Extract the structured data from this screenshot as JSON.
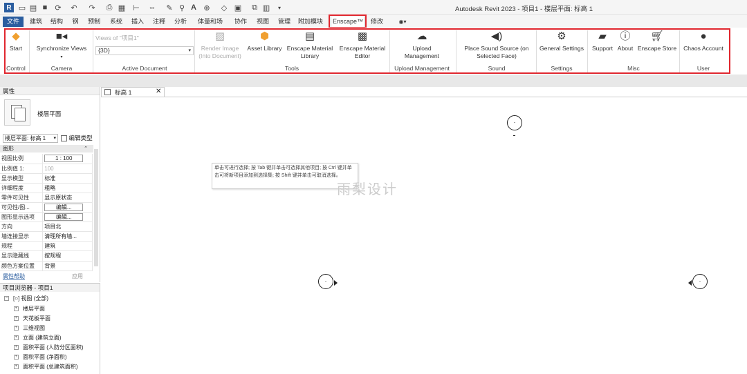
{
  "app": {
    "title": "Autodesk Revit 2023 - 项目1 - 楼层平面: 标高 1"
  },
  "tabs": [
    "文件",
    "建筑",
    "结构",
    "钢",
    "预制",
    "系统",
    "插入",
    "注释",
    "分析",
    "体量和场地",
    "协作",
    "视图",
    "管理",
    "附加模块",
    "Enscape™",
    "修改"
  ],
  "ribbon": {
    "start": "Start",
    "sync_views": "Synchronize Views",
    "views_placeholder": "Views of \"项目1\"",
    "active_view": "{3D}",
    "render_image_1": "Render Image",
    "render_image_2": "(Into Document)",
    "asset_library": "Asset Library",
    "material_library_1": "Enscape Material",
    "material_library_2": "Library",
    "material_editor_1": "Enscape Material",
    "material_editor_2": "Editor",
    "upload_1": "Upload",
    "upload_2": "Management",
    "place_sound_1": "Place Sound Source (on",
    "place_sound_2": "Selected Face)",
    "general_settings": "General Settings",
    "support": "Support",
    "about": "About",
    "store": "Enscape Store",
    "chaos_account": "Chaos Account",
    "groups": {
      "control": "Control",
      "camera": "Camera",
      "active_document": "Active Document",
      "tools": "Tools",
      "upload": "Upload Management",
      "sound": "Sound",
      "settings": "Settings",
      "misc": "Misc",
      "user": "User"
    }
  },
  "properties": {
    "title": "属性",
    "type_name": "楼层平面",
    "selector": "楼层平面: 标高 1",
    "edit_type": "编辑类型",
    "section": "图形",
    "rows": [
      {
        "k": "视图比例",
        "v": "1 : 100"
      },
      {
        "k": "比例值 1:",
        "v": "100"
      },
      {
        "k": "显示模型",
        "v": "标准"
      },
      {
        "k": "详细程度",
        "v": "粗略"
      },
      {
        "k": "零件可见性",
        "v": "显示原状态"
      },
      {
        "k": "可见性/图...",
        "v": "编辑..."
      },
      {
        "k": "图形显示选项",
        "v": "编辑..."
      },
      {
        "k": "方向",
        "v": "项目北"
      },
      {
        "k": "墙连接显示",
        "v": "清理所有墙..."
      },
      {
        "k": "规程",
        "v": "建筑"
      },
      {
        "k": "显示隐藏线",
        "v": "按规程"
      },
      {
        "k": "颜色方案位置",
        "v": "背景"
      }
    ],
    "help": "属性帮助",
    "apply": "应用"
  },
  "browser": {
    "title": "项目浏览器 - 项目1",
    "root": "视图 (全部)",
    "items": [
      "楼层平面",
      "天花板平面",
      "三维视图",
      "立面 (建筑立面)",
      "面积平面 (人防分区面积)",
      "面积平面 (净面积)",
      "面积平面 (总建筑面积)"
    ]
  },
  "view": {
    "tab": "标高 1",
    "tooltip": "单击可进行选择; 按 Tab 键并单击可选择其他项目; 按 Ctrl 键并单击可将新项目添加到选择集; 按 Shift 键并单击可取消选择。",
    "watermark": "雨梨设计"
  },
  "colors": {
    "highlight": "#e0262e",
    "file_tab": "#2a5d9f",
    "enscape_orange": "#f0a030"
  }
}
